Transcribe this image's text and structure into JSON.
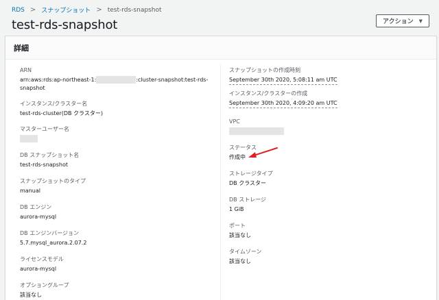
{
  "breadcrumb": {
    "items": [
      "RDS",
      "スナップショット"
    ],
    "separator": ">",
    "current": "test-rds-snapshot"
  },
  "page_title": "test-rds-snapshot",
  "action_button": {
    "label": "アクション",
    "caret": "▼"
  },
  "panel": {
    "title": "詳細"
  },
  "left": {
    "arn": {
      "label": "ARN",
      "value_prefix": "arn:aws:rds:ap-northeast-1:",
      "value_suffix": ":cluster-snapshot:test-rds-",
      "value_line2": "snapshot"
    },
    "instance": {
      "label": "インスタンス/クラスター名",
      "value": "test-rds-cluster(DB クラスター)"
    },
    "master_user": {
      "label": "マスターユーザー名"
    },
    "snapshot_name": {
      "label": "DB スナップショット名",
      "value": "test-rds-snapshot"
    },
    "snapshot_type": {
      "label": "スナップショットのタイプ",
      "value": "manual"
    },
    "engine": {
      "label": "DB エンジン",
      "value": "aurora-mysql"
    },
    "engine_version": {
      "label": "DB エンジンバージョン",
      "value": "5.7.mysql_aurora.2.07.2"
    },
    "license": {
      "label": "ライセンスモデル",
      "value": "aurora-mysql"
    },
    "option_group": {
      "label": "オプショングループ",
      "value": "該当なし"
    }
  },
  "right": {
    "snapshot_time": {
      "label": "スナップショットの作成時刻",
      "value": "September 30th 2020, 5:08:11 am UTC"
    },
    "instance_created": {
      "label": "インスタンス/クラスターの作成",
      "value": "September 30th 2020, 4:09:20 am UTC"
    },
    "vpc": {
      "label": "VPC"
    },
    "status": {
      "label": "ステータス",
      "value": "作成中"
    },
    "storage_type": {
      "label": "ストレージタイプ",
      "value": "DB クラスター"
    },
    "storage": {
      "label": "DB ストレージ",
      "value": "1 GiB"
    },
    "port": {
      "label": "ポート",
      "value": "該当なし"
    },
    "timezone": {
      "label": "タイムゾーン",
      "value": "該当なし"
    }
  },
  "colors": {
    "link": "#0073bb",
    "annotation_arrow": "#e02020",
    "redaction": "#e4e4e4"
  }
}
